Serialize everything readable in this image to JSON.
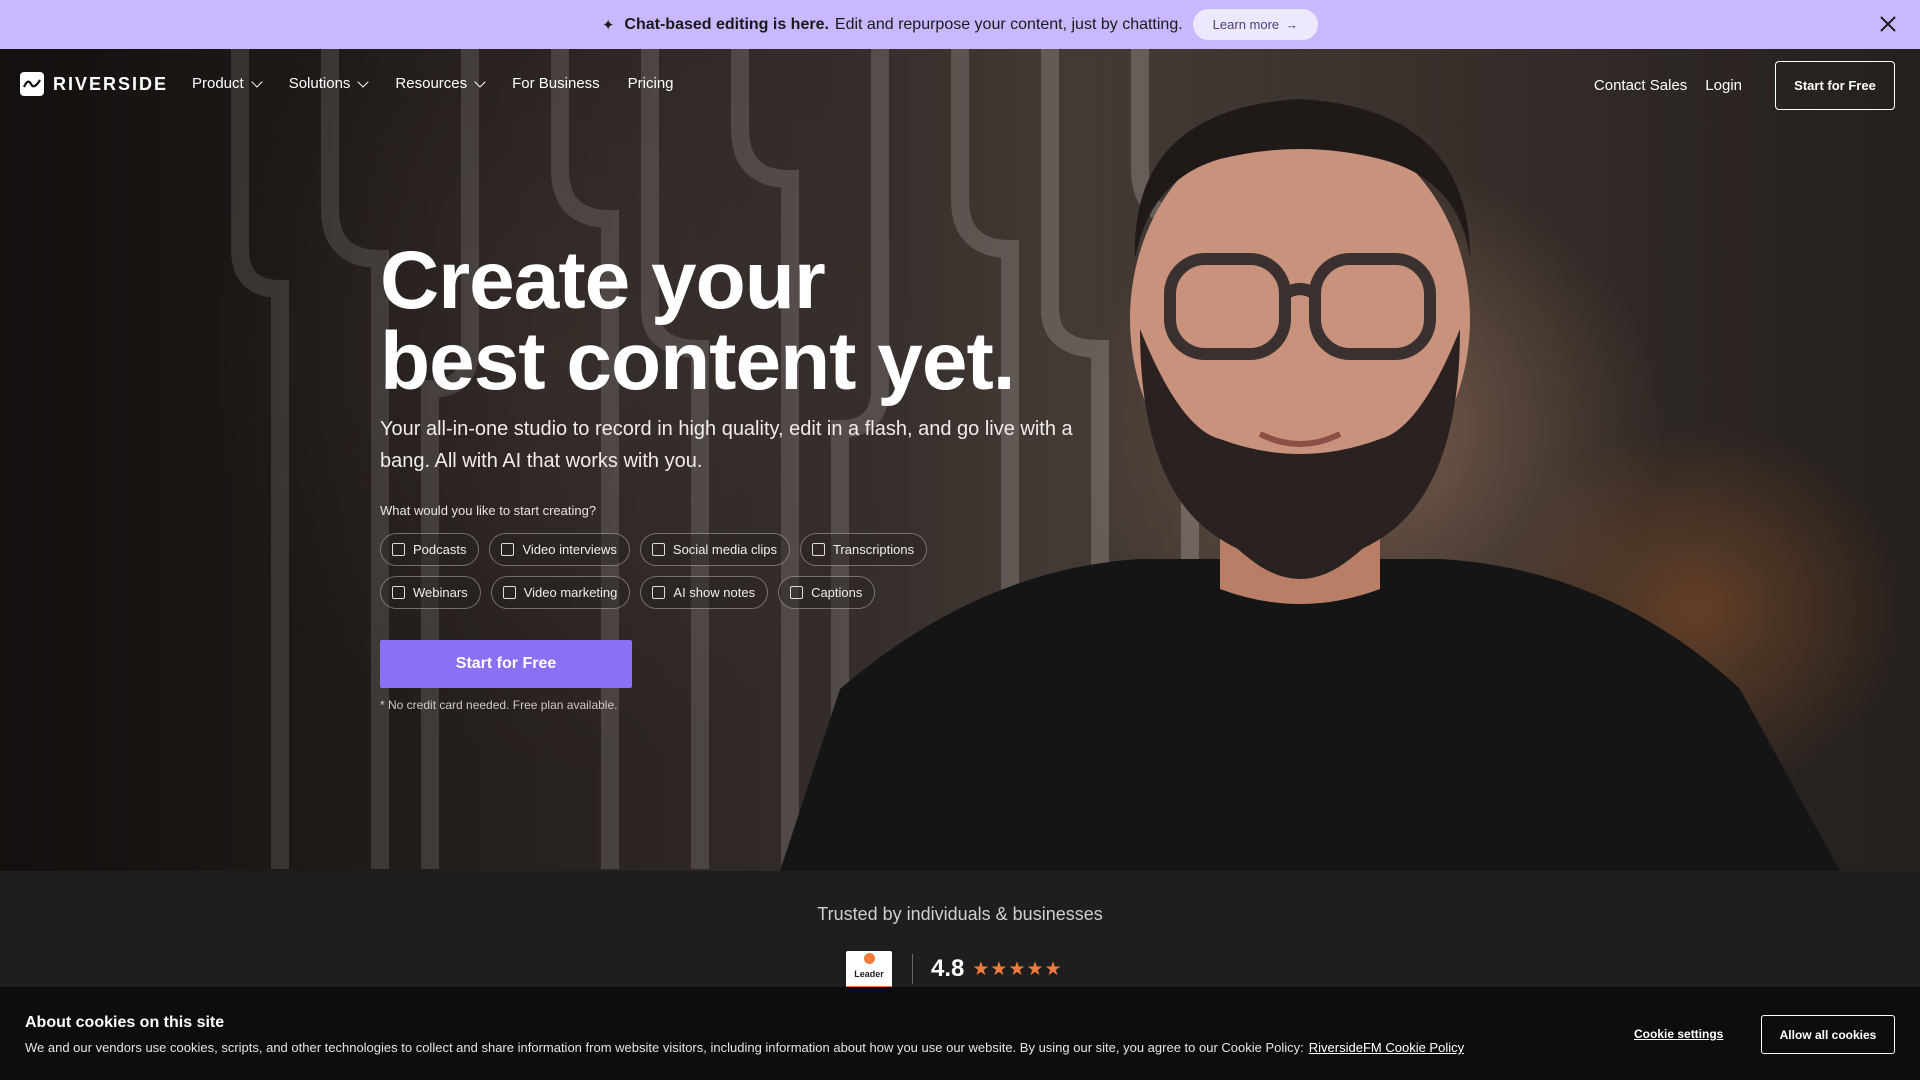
{
  "announcement": {
    "bold": "Chat-based editing is here.",
    "text": "Edit and repurpose your content, just by chatting.",
    "learn_more": "Learn more",
    "learn_more_arrow": "→"
  },
  "nav": {
    "logo": "RIVERSIDE",
    "items": [
      {
        "label": "Product",
        "dropdown": true
      },
      {
        "label": "Solutions",
        "dropdown": true
      },
      {
        "label": "Resources",
        "dropdown": true
      },
      {
        "label": "For Business",
        "dropdown": false
      },
      {
        "label": "Pricing",
        "dropdown": false
      }
    ],
    "contact_sales": "Contact Sales",
    "login": "Login",
    "start_free": "Start for Free"
  },
  "hero": {
    "headline_line1": "Create your",
    "headline_line2": "best content yet.",
    "subheading": "Your all-in-one studio to record in high quality, edit in a flash, and go live with a bang. All with AI that works with you.",
    "question": "What would you like to start creating?",
    "options_row1": [
      "Podcasts",
      "Video interviews",
      "Social media clips",
      "Transcriptions"
    ],
    "options_row2": [
      "Webinars",
      "Video marketing",
      "AI show notes",
      "Captions"
    ],
    "cta": "Start for Free",
    "note": "* No credit card needed. Free plan available."
  },
  "trusted": {
    "title": "Trusted by individuals & businesses",
    "badge_label": "Leader",
    "score": "4.8",
    "stars": "★★★★★",
    "star_rating": 5
  },
  "cookie": {
    "title": "About cookies on this site",
    "text": "We and our vendors use cookies, scripts, and other technologies to collect and share information from website visitors, including information about how you use our website. By using our site, you agree to our Cookie Policy:",
    "policy_link": "RiversideFM Cookie Policy",
    "settings": "Cookie settings",
    "allow_all": "Allow all cookies"
  },
  "colors": {
    "announcement_bg": "#c9b8ff",
    "cta_purple": "#8b6ff5",
    "star_orange": "#f07b3c"
  }
}
